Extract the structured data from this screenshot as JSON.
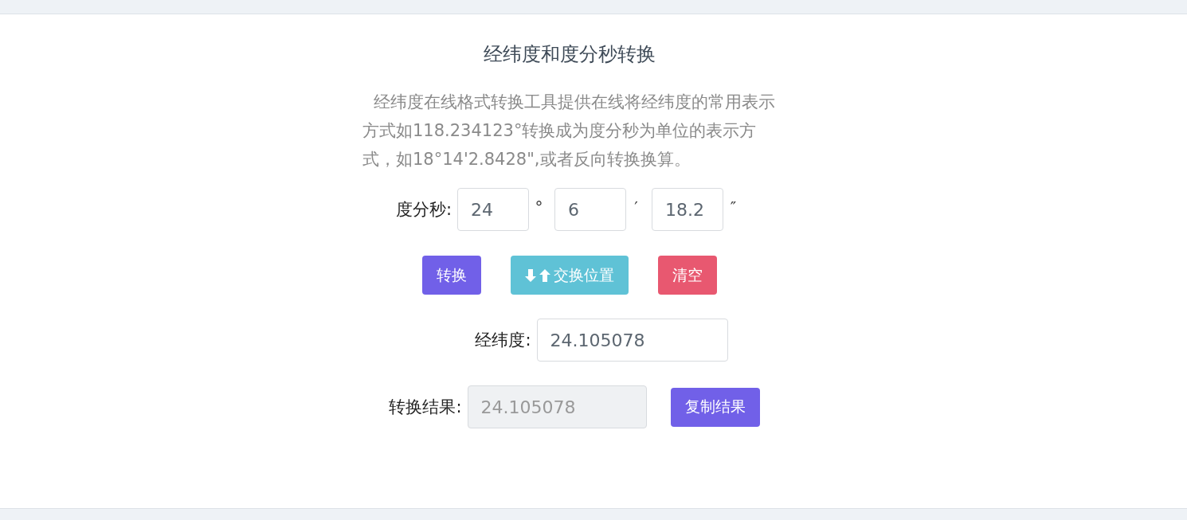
{
  "title": "经纬度和度分秒转换",
  "description": "经纬度在线格式转换工具提供在线将经纬度的常用表示方式如118.234123°转换成为度分秒为单位的表示方式，如18°14'2.8428\",或者反向转换换算。",
  "dms": {
    "label": "度分秒:",
    "fields": [
      {
        "value": "24",
        "unit": "°"
      },
      {
        "value": "6",
        "unit": "′"
      },
      {
        "value": "18.2",
        "unit": "″"
      }
    ]
  },
  "buttons": [
    {
      "label": "转换",
      "kind": "primary"
    },
    {
      "label": "交换位置",
      "kind": "swap"
    },
    {
      "label": "清空",
      "kind": "danger"
    }
  ],
  "decimal": {
    "label": "经纬度:",
    "value": "24.105078",
    "disabled": false
  },
  "result": {
    "label": "转换结果:",
    "value": "24.105078",
    "disabled": true
  },
  "copy_button": {
    "label": "复制结果",
    "kind": "primary"
  }
}
